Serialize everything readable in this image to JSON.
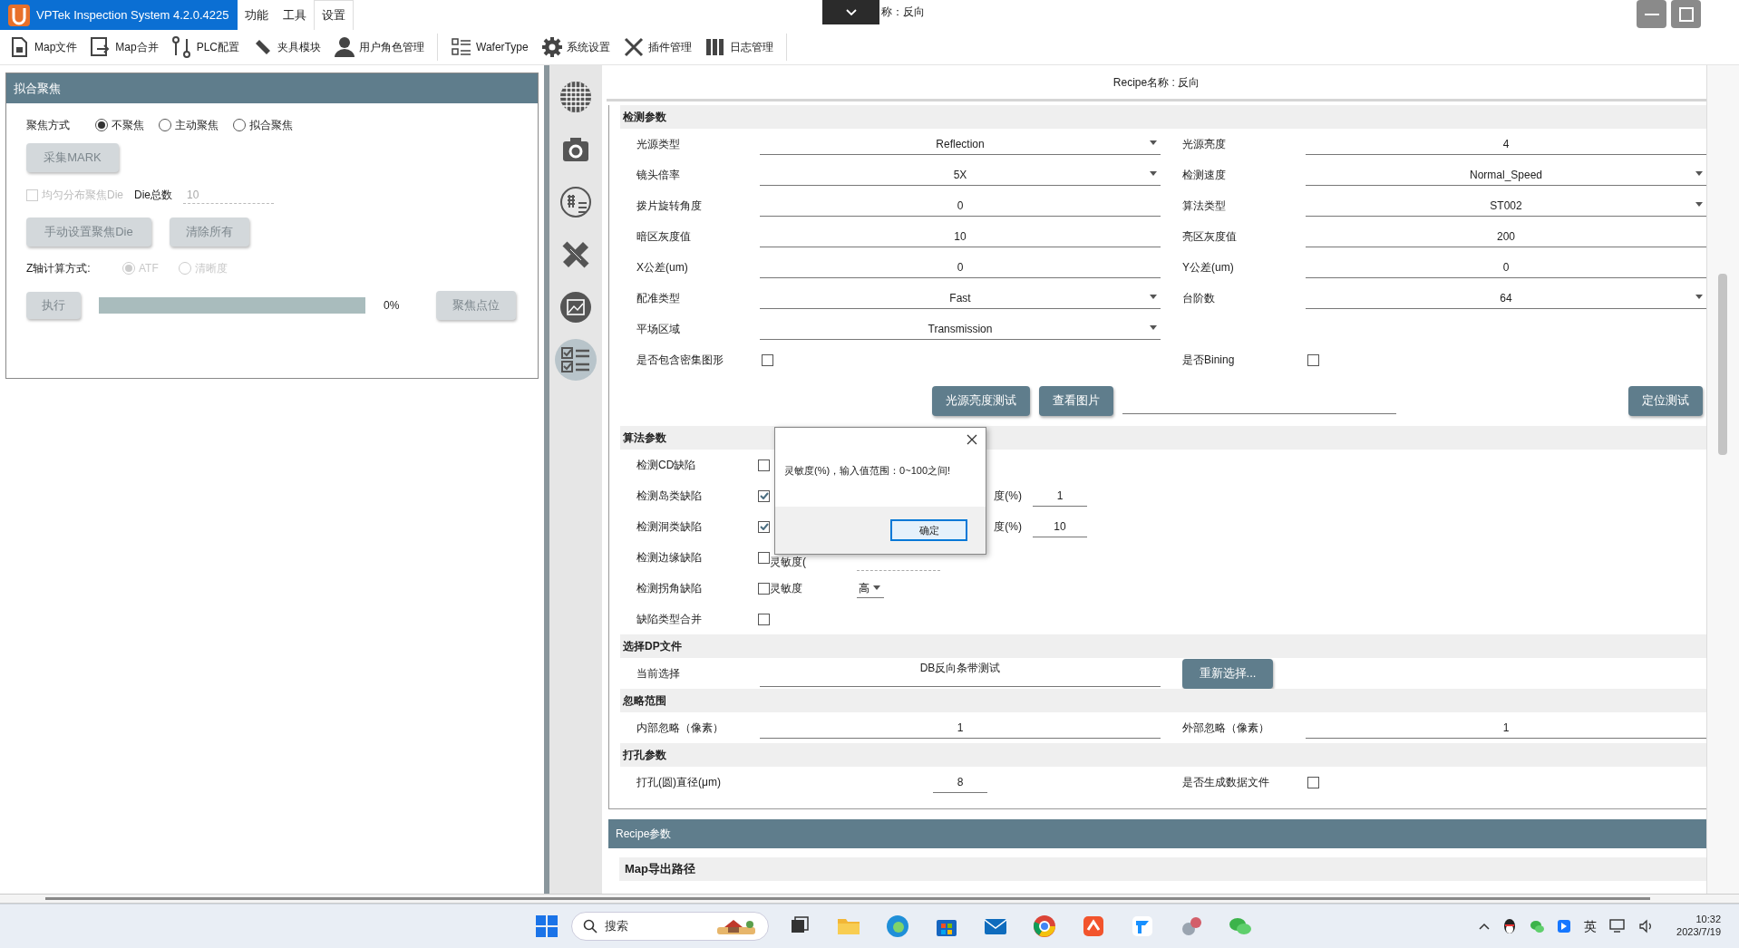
{
  "app": {
    "title": "VPTek Inspection System 4.2.0.4225",
    "menu": [
      {
        "label": "功能",
        "selected": false
      },
      {
        "label": "工具",
        "selected": false
      },
      {
        "label": "设置",
        "selected": true
      }
    ],
    "recipe_hint": "称：反向"
  },
  "toolbar": [
    "Map文件",
    "Map合并",
    "PLC配置",
    "夹具模块",
    "用户角色管理",
    "WaferType",
    "系统设置",
    "插件管理",
    "日志管理"
  ],
  "left_panel": {
    "title": "拟合聚焦",
    "focus_label": "聚焦方式",
    "focus_options": [
      {
        "label": "不聚焦",
        "selected": true
      },
      {
        "label": "主动聚焦",
        "selected": false
      },
      {
        "label": "拟合聚焦",
        "selected": false
      }
    ],
    "mark_button": "采集MARK",
    "uniform": {
      "label": "均匀分布聚焦Die",
      "checked": false
    },
    "die_total_label": "Die总数",
    "die_total": "10",
    "manual_button": "手动设置聚焦Die",
    "clear_button": "清除所有",
    "z_label": "Z轴计算方式:",
    "z_options": [
      {
        "label": "ATF",
        "selected": true
      },
      {
        "label": "清晰度",
        "selected": false
      }
    ],
    "run_button": "执行",
    "progress": {
      "level": 0,
      "reading": "0%"
    },
    "focus_point_button": "聚焦点位"
  },
  "sidebar": [
    {
      "selected": false
    },
    {
      "selected": false
    },
    {
      "selected": false
    },
    {
      "selected": false
    },
    {
      "selected": false
    },
    {
      "selected": true
    }
  ],
  "recipe_name": "Recipe名称 : 反向",
  "detection": {
    "title": "检测参数",
    "rows": [
      [
        {
          "label": "光源类型",
          "kind": "dropdown",
          "value": "Reflection"
        },
        {
          "label": "光源亮度",
          "kind": "input",
          "value": "4"
        }
      ],
      [
        {
          "label": "镜头倍率",
          "kind": "dropdown",
          "value": "5X"
        },
        {
          "label": "检测速度",
          "kind": "dropdown",
          "value": "Normal_Speed"
        }
      ],
      [
        {
          "label": "拨片旋转角度",
          "kind": "input",
          "value": "0"
        },
        {
          "label": "算法类型",
          "kind": "dropdown",
          "value": "ST002"
        }
      ],
      [
        {
          "label": "暗区灰度值",
          "kind": "input",
          "value": "10"
        },
        {
          "label": "亮区灰度值",
          "kind": "input",
          "value": "200"
        }
      ],
      [
        {
          "label": "X公差(um)",
          "kind": "input",
          "value": "0"
        },
        {
          "label": "Y公差(um)",
          "kind": "input",
          "value": "0"
        }
      ],
      [
        {
          "label": "配准类型",
          "kind": "dropdown",
          "value": "Fast"
        },
        {
          "label": "台阶数",
          "kind": "dropdown",
          "value": "64"
        }
      ],
      [
        {
          "label": "平场区域",
          "kind": "dropdown",
          "value": "Transmission"
        }
      ],
      [
        {
          "label": "是否包含密集图形",
          "kind": "checkbox",
          "checked": false
        },
        {
          "label": "是否Bining",
          "kind": "checkbox",
          "checked": false
        }
      ]
    ],
    "buttons": [
      "光源亮度测试",
      "查看图片",
      "定位测试"
    ]
  },
  "algorithm": {
    "title": "算法参数",
    "rows": [
      {
        "label": "检测CD缺陷",
        "checked": false
      },
      {
        "label": "检测岛类缺陷",
        "checked": true,
        "extra": {
          "kind": "input",
          "label": "度(%)",
          "value": "1"
        }
      },
      {
        "label": "检测洞类缺陷",
        "checked": true,
        "extra": {
          "kind": "input",
          "label": "度(%)",
          "value": "10"
        }
      },
      {
        "label": "检测边缘缺陷",
        "checked": false,
        "extra": {
          "kind": "dashed",
          "label": "灵敏度("
        }
      },
      {
        "label": "检测拐角缺陷",
        "checked": false,
        "extra": {
          "kind": "dropdown",
          "label": "灵敏度",
          "value": "高"
        }
      },
      {
        "label": "缺陷类型合并",
        "checked": false
      }
    ]
  },
  "dp": {
    "title": "选择DP文件",
    "label": "当前选择",
    "value": "DB反向条带测试",
    "button": "重新选择..."
  },
  "ignore": {
    "title": "忽略范围",
    "inner_label": "内部忽略（像素）",
    "inner": "1",
    "outer_label": "外部忽略（像素）",
    "outer": "1"
  },
  "punch": {
    "title": "打孔参数",
    "label": "打孔(圆)直径(μm)",
    "value": "8",
    "file_label": "是否生成数据文件",
    "file_checked": false
  },
  "recipe_params": {
    "title": "Recipe参数",
    "sub": "Map导出路径"
  },
  "dialog": {
    "message": "灵敏度(%)，输入值范围：0~100之间!",
    "button": "确定"
  },
  "taskbar": {
    "search": "搜索",
    "ime": "英",
    "time": "10:32",
    "date": "2023/7/19"
  }
}
